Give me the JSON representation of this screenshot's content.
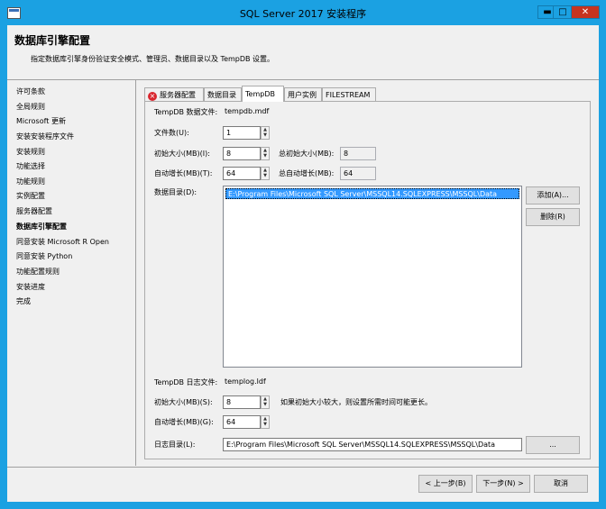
{
  "window": {
    "title": "SQL Server 2017 安装程序",
    "min_label": "▬",
    "max_label": "□",
    "close_label": "✕"
  },
  "header": {
    "title": "数据库引擎配置",
    "subtitle": "指定数据库引擎身份验证安全模式、管理员、数据目录以及 TempDB 设置。"
  },
  "sidebar": {
    "items": [
      "许可条款",
      "全局规则",
      "Microsoft 更新",
      "安装安装程序文件",
      "安装规则",
      "功能选择",
      "功能规则",
      "实例配置",
      "服务器配置",
      "数据库引擎配置",
      "同意安装 Microsoft R Open",
      "同意安装 Python",
      "功能配置规则",
      "安装进度",
      "完成"
    ],
    "active_index": 9
  },
  "tabs": {
    "items": [
      "服务器配置",
      "数据目录",
      "TempDB",
      "用户实例",
      "FILESTREAM"
    ],
    "active": "TempDB",
    "error_icon": "×"
  },
  "tempdb": {
    "data_file_label": "TempDB 数据文件:",
    "data_file_value": "tempdb.mdf",
    "file_count_label": "文件数(U):",
    "file_count": "1",
    "initial_size_label": "初始大小(MB)(I):",
    "initial_size": "8",
    "total_initial_label": "总初始大小(MB):",
    "total_initial": "8",
    "autogrowth_label": "自动增长(MB)(T):",
    "autogrowth": "64",
    "total_autogrowth_label": "总自动增长(MB):",
    "total_autogrowth": "64",
    "data_dir_label": "数据目录(D):",
    "data_dirs": [
      "E:\\Program Files\\Microsoft SQL Server\\MSSQL14.SQLEXPRESS\\MSSQL\\Data"
    ],
    "add_button": "添加(A)...",
    "remove_button": "删除(R)",
    "log_file_label": "TempDB 日志文件:",
    "log_file_value": "templog.ldf",
    "log_initial_label": "初始大小(MB)(S):",
    "log_initial": "8",
    "log_hint": "如果初始大小较大，则设置所需时间可能更长。",
    "log_autogrowth_label": "自动增长(MB)(G):",
    "log_autogrowth": "64",
    "log_dir_label": "日志目录(L):",
    "log_dir": "E:\\Program Files\\Microsoft SQL Server\\MSSQL14.SQLEXPRESS\\MSSQL\\Data",
    "browse_button": "..."
  },
  "footer": {
    "back": "< 上一步(B)",
    "next": "下一步(N) >",
    "cancel": "取消"
  },
  "spinner": {
    "up": "▲",
    "down": "▼"
  }
}
